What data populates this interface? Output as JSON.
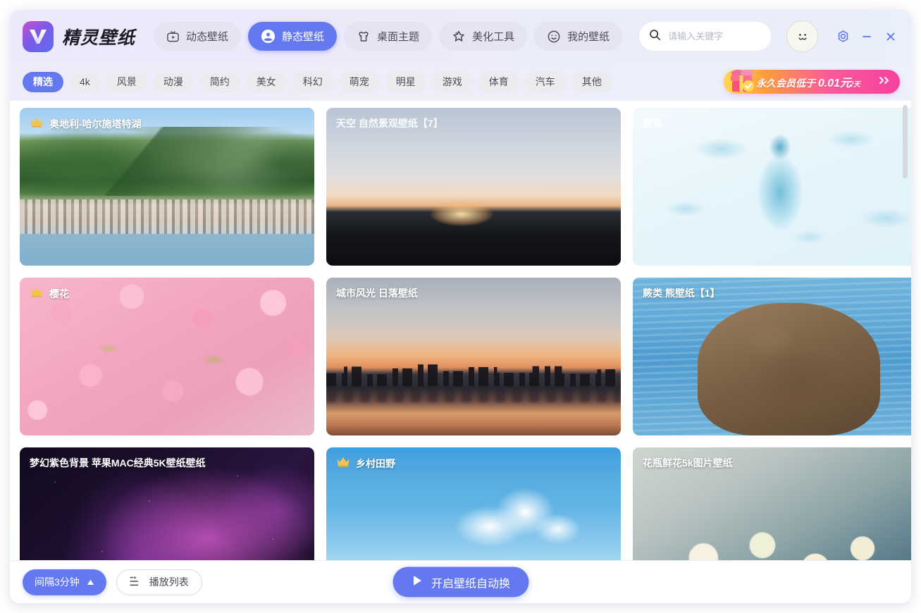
{
  "app": {
    "title": "精灵壁纸",
    "logo_icon": "wallpaper-logo-icon"
  },
  "header": {
    "tabs": [
      {
        "label": "动态壁纸",
        "icon": "dynamic-wallpaper-icon",
        "active": false
      },
      {
        "label": "静态壁纸",
        "icon": "static-wallpaper-icon",
        "active": true
      },
      {
        "label": "桌面主题",
        "icon": "desktop-theme-icon",
        "active": false
      },
      {
        "label": "美化工具",
        "icon": "beautify-tool-icon",
        "active": false
      },
      {
        "label": "我的壁纸",
        "icon": "my-wallpaper-icon",
        "active": false
      }
    ],
    "search": {
      "placeholder": "请输入关键字",
      "value": "",
      "icon": "search-icon"
    },
    "avatar_icon": "smiley-face-icon",
    "window_controls": [
      {
        "name": "settings-button",
        "icon": "gear-icon"
      },
      {
        "name": "minimize-button",
        "icon": "minimize-icon"
      },
      {
        "name": "close-button",
        "icon": "close-icon"
      }
    ],
    "accent_color": "#6479f0"
  },
  "categories": {
    "items": [
      {
        "label": "精选",
        "active": true
      },
      {
        "label": "4k",
        "active": false
      },
      {
        "label": "风景",
        "active": false
      },
      {
        "label": "动漫",
        "active": false
      },
      {
        "label": "简约",
        "active": false
      },
      {
        "label": "美女",
        "active": false
      },
      {
        "label": "科幻",
        "active": false
      },
      {
        "label": "萌宠",
        "active": false
      },
      {
        "label": "明星",
        "active": false
      },
      {
        "label": "游戏",
        "active": false
      },
      {
        "label": "体育",
        "active": false
      },
      {
        "label": "汽车",
        "active": false
      },
      {
        "label": "其他",
        "active": false
      }
    ]
  },
  "vip_banner": {
    "text_prefix": "永久会员低于",
    "price": "0.01元",
    "unit": "/天",
    "arrows": "»",
    "gift_icon": "gift-box-icon",
    "color_start": "#ffd84d",
    "color_end": "#f5429e"
  },
  "wallpapers": {
    "items": [
      {
        "title": "奥地利-哈尔施塔特湖",
        "vip": true,
        "art": "art-hallstatt",
        "faint": false
      },
      {
        "title": "天空 自然景观壁纸【7】",
        "vip": false,
        "art": "art-sky",
        "faint": true
      },
      {
        "title": "碧落",
        "vip": false,
        "art": "art-biluo",
        "faint": true
      },
      {
        "title": "樱花",
        "vip": true,
        "art": "art-sakura",
        "faint": false
      },
      {
        "title": "城市风光 日落壁纸",
        "vip": false,
        "art": "art-city",
        "faint": false
      },
      {
        "title": "蕨类 熊壁纸【1】",
        "vip": false,
        "art": "art-bear",
        "faint": false
      },
      {
        "title": "梦幻紫色背景 苹果MAC经典5K壁纸壁纸",
        "vip": false,
        "art": "art-aurora",
        "faint": false
      },
      {
        "title": "乡村田野",
        "vip": true,
        "art": "art-country",
        "faint": false
      },
      {
        "title": "花瓶鲜花5k图片壁纸",
        "vip": false,
        "art": "art-flowers",
        "faint": false
      }
    ],
    "vip_badge_icon": "crown-icon"
  },
  "footer": {
    "interval_label": "间隔3分钟",
    "interval_caret": "▲",
    "playlist_label": "播放列表",
    "playlist_icon": "list-icon",
    "autoswitch_label": "开启壁纸自动换",
    "autoswitch_icon": "play-icon"
  }
}
